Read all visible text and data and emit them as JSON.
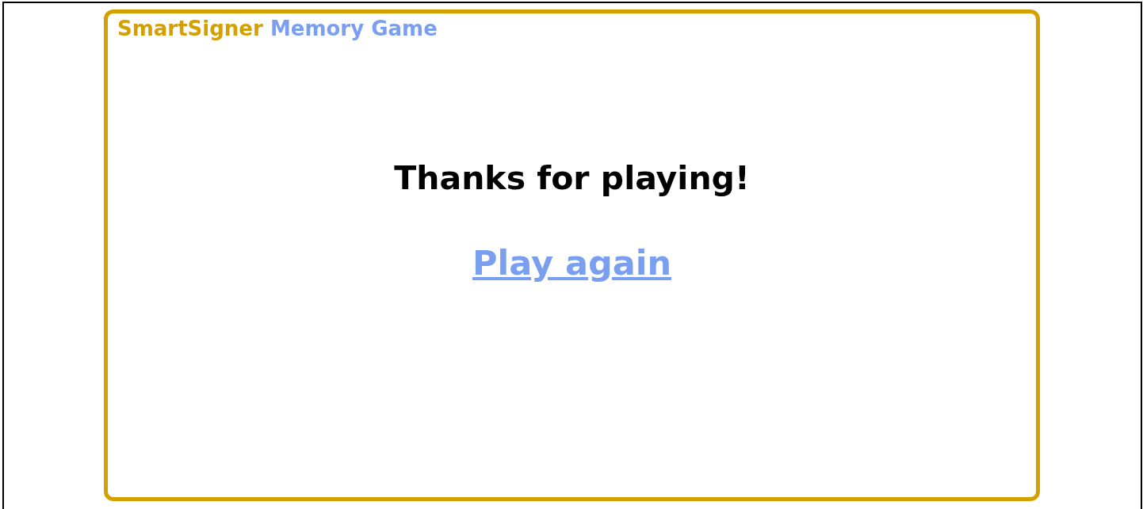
{
  "title": {
    "brand": "SmartSigner",
    "name": "Memory Game"
  },
  "message": "Thanks for playing!",
  "play_again_link": "Play again"
}
